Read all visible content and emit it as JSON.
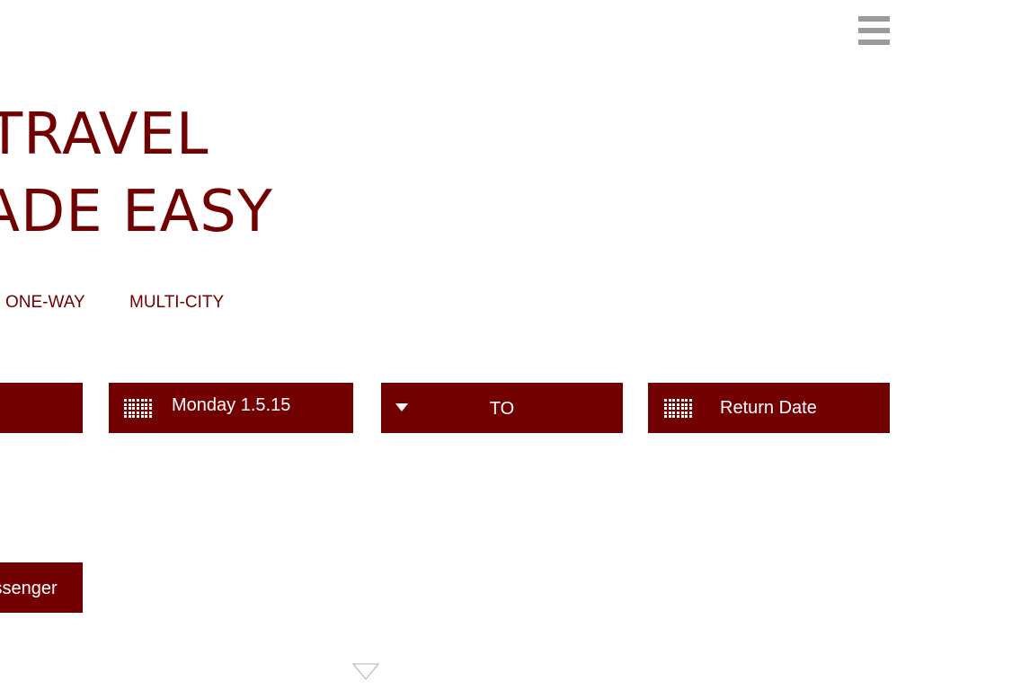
{
  "header": {
    "menu_icon": "hamburger-menu-icon",
    "menu_color": "#9a9a9a"
  },
  "hero": {
    "line1": "TRAVEL",
    "line2": "MADE EASY",
    "color": "#720000"
  },
  "trip_types": [
    {
      "label": "ONE-WAY"
    },
    {
      "label": "MULTI-CITY"
    }
  ],
  "search_form": {
    "accent": "#720000",
    "from": {
      "value": ""
    },
    "depart_date": {
      "value": "Monday 1.5.15",
      "icon": "calendar-icon"
    },
    "to": {
      "label": "TO",
      "icon": "caret-down-icon"
    },
    "return_date": {
      "placeholder": "Return Date",
      "icon": "calendar-icon"
    },
    "passenger": {
      "label": "Passenger"
    }
  },
  "scroll_indicator": {
    "icon": "chevron-down-outline-icon"
  }
}
